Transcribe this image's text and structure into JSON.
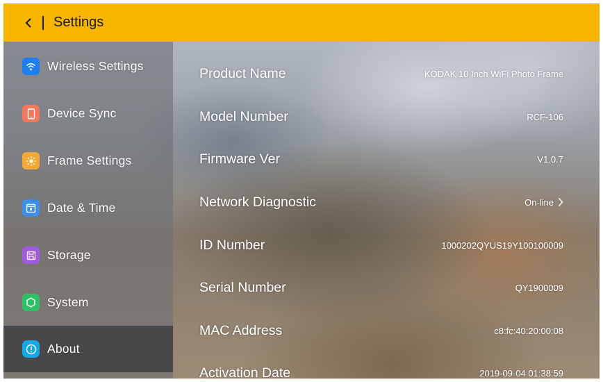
{
  "header": {
    "back_icon": "chevron-left-icon",
    "title": "Settings",
    "color": "#f7b500"
  },
  "sidebar": {
    "items": [
      {
        "label": "Wireless Settings",
        "icon": "wifi-icon",
        "color": "#1f7ef2"
      },
      {
        "label": "Device Sync",
        "icon": "phone-icon",
        "color": "#f2785a"
      },
      {
        "label": "Frame Settings",
        "icon": "sun-icon",
        "color": "#f4a838"
      },
      {
        "label": "Date & Time",
        "icon": "calendar-icon",
        "color": "#3b8fe8"
      },
      {
        "label": "Storage",
        "icon": "storage-icon",
        "color": "#a25be0"
      },
      {
        "label": "System",
        "icon": "shield-icon",
        "color": "#2fbf64"
      },
      {
        "label": "About",
        "icon": "info-icon",
        "color": "#16a7e8",
        "active": true
      }
    ]
  },
  "about": {
    "rows": [
      {
        "label": "Product Name",
        "value": "KODAK 10 Inch WiFi Photo Frame"
      },
      {
        "label": "Model Number",
        "value": "RCF-106"
      },
      {
        "label": "Firmware Ver",
        "value": "V1.0.7"
      },
      {
        "label": "Network Diagnostic",
        "value": "On-line",
        "chevron": "chevron-right-icon"
      },
      {
        "label": "ID Number",
        "value": "1000202QYUS19Y100100009"
      },
      {
        "label": "Serial Number",
        "value": "QY1900009"
      },
      {
        "label": "MAC Address",
        "value": "c8:fc:40:20:00:08"
      },
      {
        "label": "Activation Date",
        "value": "2019-09-04 01:38:59"
      }
    ]
  }
}
